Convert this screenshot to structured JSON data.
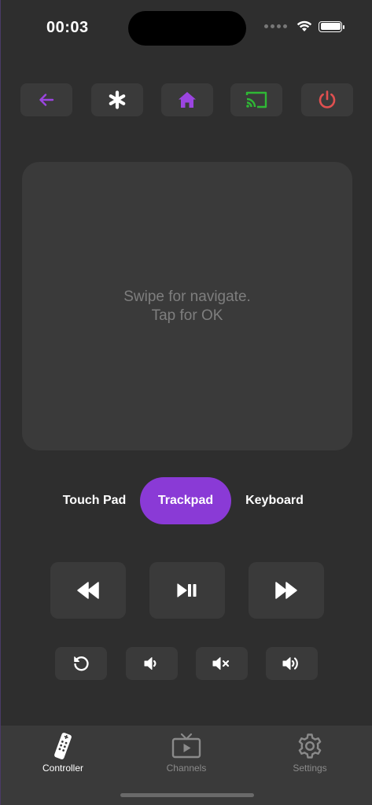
{
  "status_bar": {
    "time": "00:03"
  },
  "colors": {
    "accent": "#8a3ad6",
    "cast": "#2fb835",
    "power": "#e05050",
    "tab_active": "#ffffff",
    "tab_inactive": "#8a8a8a"
  },
  "toolbar": {
    "buttons": [
      {
        "name": "back",
        "icon": "arrow-left-icon"
      },
      {
        "name": "asterisk",
        "icon": "asterisk-icon"
      },
      {
        "name": "home",
        "icon": "home-icon"
      },
      {
        "name": "cast",
        "icon": "cast-icon"
      },
      {
        "name": "power",
        "icon": "power-icon"
      }
    ]
  },
  "pad": {
    "line1": "Swipe for navigate.",
    "line2": "Tap for OK"
  },
  "modes": {
    "selected": "Trackpad",
    "options": [
      "Touch Pad",
      "Trackpad",
      "Keyboard"
    ]
  },
  "media": {
    "buttons": [
      {
        "name": "rewind",
        "icon": "rewind-icon"
      },
      {
        "name": "play-pause",
        "icon": "play-pause-icon"
      },
      {
        "name": "fast-forward",
        "icon": "fast-forward-icon"
      }
    ]
  },
  "secondary": {
    "buttons": [
      {
        "name": "replay",
        "icon": "replay-icon"
      },
      {
        "name": "volume-down",
        "icon": "volume-down-icon"
      },
      {
        "name": "mute",
        "icon": "volume-mute-icon"
      },
      {
        "name": "volume-up",
        "icon": "volume-up-icon"
      }
    ]
  },
  "tabbar": {
    "tabs": [
      {
        "label": "Controller",
        "icon": "remote-icon",
        "active": true
      },
      {
        "label": "Channels",
        "icon": "tv-icon",
        "active": false
      },
      {
        "label": "Settings",
        "icon": "gear-icon",
        "active": false
      }
    ]
  }
}
